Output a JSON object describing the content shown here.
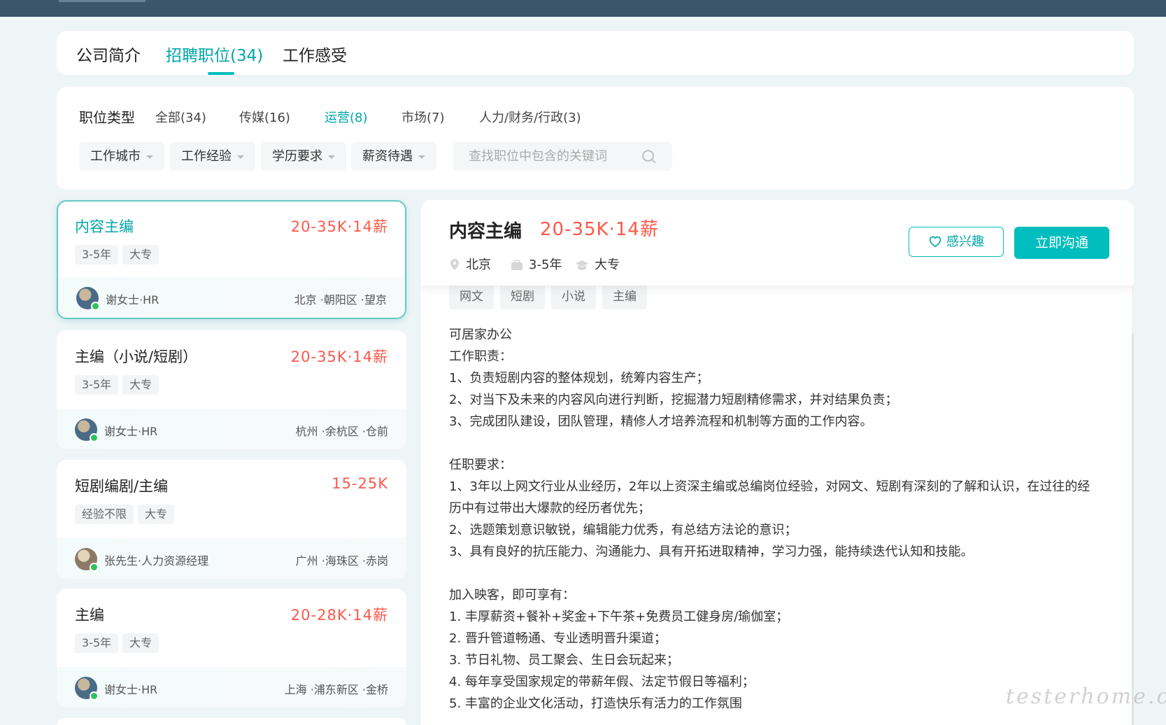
{
  "tabs": [
    {
      "label": "公司简介",
      "active": false
    },
    {
      "label": "招聘职位(34)",
      "active": true
    },
    {
      "label": "工作感受",
      "active": false
    }
  ],
  "filter": {
    "title": "职位类型",
    "categories": [
      {
        "label": "全部(34)",
        "active": false
      },
      {
        "label": "传媒(16)",
        "active": false
      },
      {
        "label": "运营(8)",
        "active": true
      },
      {
        "label": "市场(7)",
        "active": false
      },
      {
        "label": "人力/财务/行政(3)",
        "active": false
      }
    ],
    "dropdowns": [
      "工作城市",
      "工作经验",
      "学历要求",
      "薪资待遇"
    ],
    "search_placeholder": "查找职位中包含的关键词"
  },
  "jobs": [
    {
      "title": "内容主编",
      "salary": "20-35K·14薪",
      "tags": [
        "3-5年",
        "大专"
      ],
      "hr": "谢女士·HR",
      "location": "北京 ·朝阳区 ·望京",
      "active": true
    },
    {
      "title": "主编（小说/短剧）",
      "salary": "20-35K·14薪",
      "tags": [
        "3-5年",
        "大专"
      ],
      "hr": "谢女士·HR",
      "location": "杭州 ·余杭区 ·仓前",
      "active": false
    },
    {
      "title": "短剧编剧/主编",
      "salary": "15-25K",
      "tags": [
        "经验不限",
        "大专"
      ],
      "hr": "张先生·人力资源经理",
      "location": "广州 ·海珠区 ·赤岗",
      "active": false
    },
    {
      "title": "主编",
      "salary": "20-28K·14薪",
      "tags": [
        "3-5年",
        "大专"
      ],
      "hr": "谢女士·HR",
      "location": "上海 ·浦东新区 ·金桥",
      "active": false
    }
  ],
  "detail": {
    "title": "内容主编",
    "salary": "20-35K·14薪",
    "city": "北京",
    "experience": "3-5年",
    "education": "大专",
    "interest_label": "感兴趣",
    "chat_label": "立即沟通",
    "tags": [
      "网文",
      "短剧",
      "小说",
      "主编"
    ],
    "description": [
      "可居家办公",
      "工作职责：",
      "1、负责短剧内容的整体规划，统筹内容生产；",
      "2、对当下及未来的内容风向进行判断，挖掘潜力短剧精修需求，并对结果负责；",
      "3、完成团队建设，团队管理，精修人才培养流程和机制等方面的工作内容。",
      "",
      "任职要求：",
      "1、3年以上网文行业从业经历，2年以上资深主编或总编岗位经验，对网文、短剧有深刻的了解和认识，在过往的经",
      "历中有过带出大爆款的经历者优先；",
      "2、选题策划意识敏锐，编辑能力优秀，有总结方法论的意识；",
      "3、具有良好的抗压能力、沟通能力、具有开拓进取精神，学习力强，能持续迭代认知和技能。",
      "",
      "加入映客，即可享有：",
      "1. 丰厚薪资+餐补+奖金+下午茶+免费员工健身房/瑜伽室；",
      "2. 晋升管道畅通、专业透明晋升渠道；",
      "3. 节日礼物、员工聚会、生日会玩起来；",
      "4. 每年享受国家规定的带薪年假、法定节假日等福利；",
      "5. 丰富的企业文化活动，打造快乐有活力的工作氛围"
    ]
  },
  "watermark": "testerhome.com"
}
